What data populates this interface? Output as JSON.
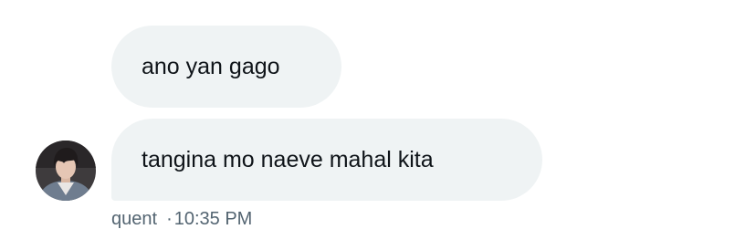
{
  "messages": [
    {
      "text": "ano yan gago"
    },
    {
      "text": "tangina mo naeve mahal kita"
    }
  ],
  "meta": {
    "sender": "quent",
    "separator": "·",
    "time": "10:35 PM"
  },
  "colors": {
    "bubble_bg": "#eff3f4",
    "text": "#0f1419",
    "meta_text": "#536471"
  }
}
